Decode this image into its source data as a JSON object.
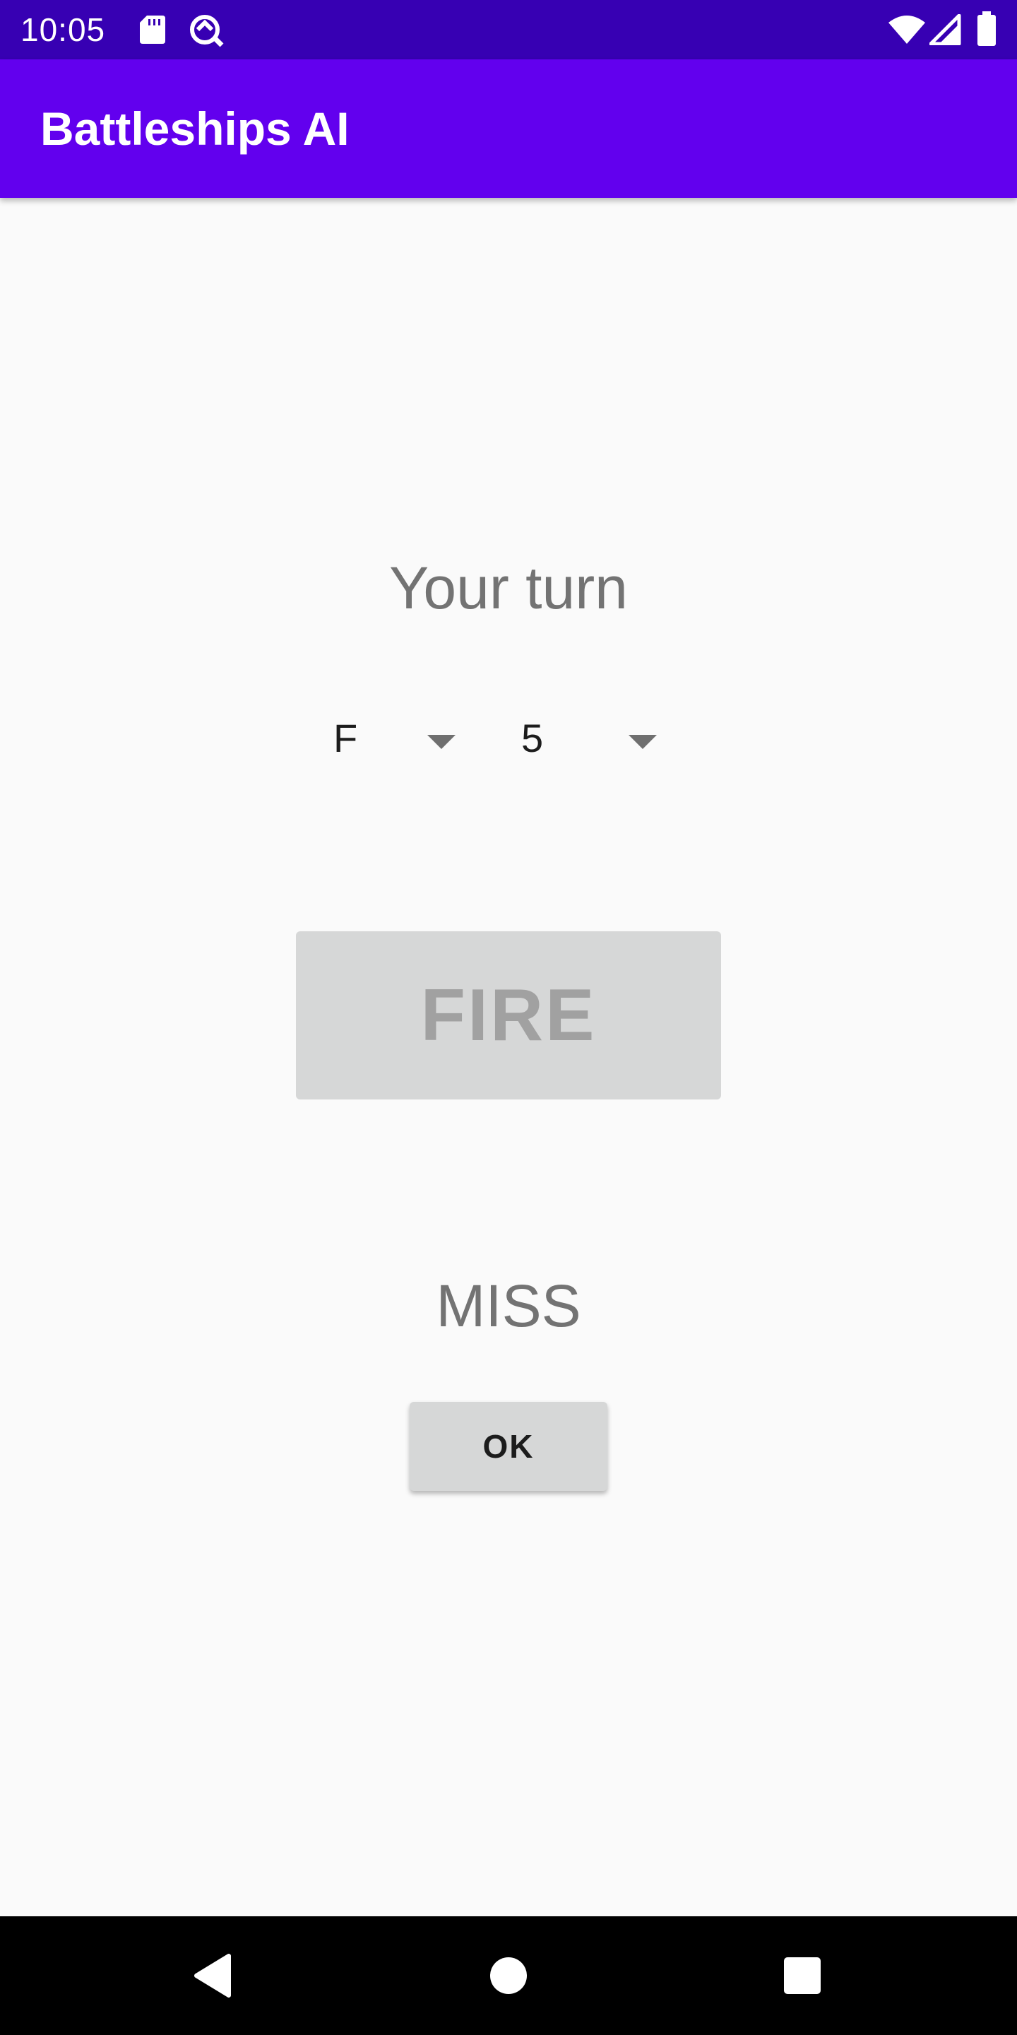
{
  "status_bar": {
    "time": "10:05",
    "left_icons": [
      "sd-card-icon",
      "data-saver-icon"
    ],
    "right_icons": [
      "wifi-icon",
      "cell-signal-icon",
      "battery-icon"
    ]
  },
  "app_bar": {
    "title": "Battleships AI"
  },
  "game": {
    "turn_text": "Your turn",
    "row_spinner": {
      "selected": "F"
    },
    "column_spinner": {
      "selected": "5"
    },
    "fire_label": "FIRE",
    "result_text": "MISS",
    "ok_label": "OK"
  },
  "nav_bar": {
    "icons": [
      "back-icon",
      "home-icon",
      "recents-icon"
    ]
  },
  "colors": {
    "status_bar": "#3700b3",
    "app_bar": "#6200ee",
    "background": "#fafafa",
    "button_fill": "#d6d7d7",
    "muted_text": "#737373"
  }
}
